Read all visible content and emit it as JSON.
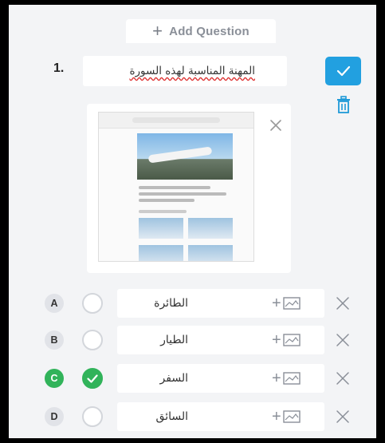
{
  "toolbar": {
    "add_question_label": "Add Question",
    "add_question_icon": "plus-icon"
  },
  "question": {
    "number": "1.",
    "text": "المهنة المناسبة لهذه السورة",
    "confirm_icon": "check-icon",
    "delete_icon": "trash-icon",
    "accent_color": "#22a0e0"
  },
  "attachment": {
    "remove_icon": "close-icon"
  },
  "options": [
    {
      "letter": "A",
      "text": "الطائرة",
      "correct": false
    },
    {
      "letter": "B",
      "text": "الطيار",
      "correct": false
    },
    {
      "letter": "C",
      "text": "السفر",
      "correct": true
    },
    {
      "letter": "D",
      "text": "السائق",
      "correct": false
    }
  ],
  "colors": {
    "correct": "#31b35a",
    "background": "#f3f4f6"
  }
}
